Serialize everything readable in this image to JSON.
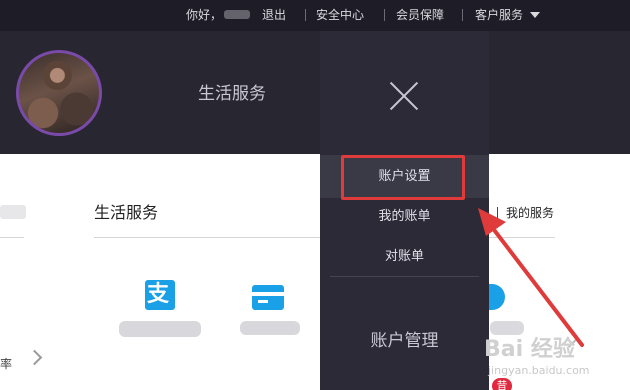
{
  "topbar": {
    "greeting": "你好，",
    "logout": "退出",
    "security_center": "安全中心",
    "member_protection": "会员保障",
    "customer_service": "客户服务"
  },
  "header": {
    "title": "生活服务"
  },
  "content": {
    "section_title": "生活服务",
    "right_link": "我的服务",
    "left_fragment": "率"
  },
  "apps": [
    {
      "icon": "alipay-icon",
      "glyph": "支"
    },
    {
      "icon": "bank-card-icon"
    },
    {
      "icon": "app-icon-blue"
    }
  ],
  "badge": {
    "text": "昔"
  },
  "dropdown": {
    "items": [
      {
        "label": "账户设置",
        "highlighted": true
      },
      {
        "label": "我的账单",
        "highlighted": false
      },
      {
        "label": "对账单",
        "highlighted": false
      }
    ],
    "section_label": "账户管理"
  },
  "watermark": {
    "line1": "Bai 经验",
    "line2": "jingyan.baidu.com"
  },
  "colors": {
    "topbar_bg": "#1e1d27",
    "header_bg": "#272631",
    "dropdown_bg": "#2b2a36",
    "highlight_box": "#e03b3b",
    "accent_blue": "#1aa0e6"
  }
}
